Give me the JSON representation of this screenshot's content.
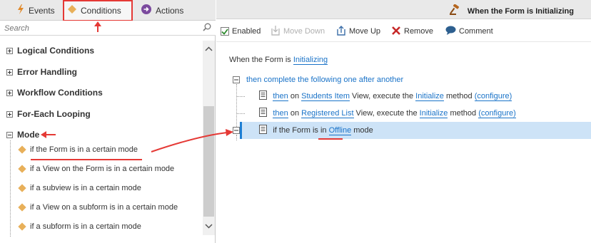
{
  "tabs": [
    {
      "label": "Events",
      "icon": "lightning-icon"
    },
    {
      "label": "Conditions",
      "icon": "diamond-icon"
    },
    {
      "label": "Actions",
      "icon": "arrow-right-circle-icon"
    }
  ],
  "search": {
    "placeholder": "Search"
  },
  "groups": [
    {
      "label": "Logical Conditions",
      "expanded": false
    },
    {
      "label": "Error Handling",
      "expanded": false
    },
    {
      "label": "Workflow Conditions",
      "expanded": false
    },
    {
      "label": "For-Each Looping",
      "expanded": false
    },
    {
      "label": "Mode",
      "expanded": true
    }
  ],
  "mode_items": [
    "if the Form is in a certain mode",
    "if a View on the Form is in a certain mode",
    "if a subview is in a certain mode",
    "if a View on a subform is in a certain mode",
    "if a subform is in a certain mode"
  ],
  "header": {
    "title": "When the Form is Initializing",
    "icon": "gavel-icon"
  },
  "toolbar": {
    "enabled": "Enabled",
    "enabled_checked": true,
    "move_down": "Move Down",
    "move_up": "Move Up",
    "remove": "Remove",
    "comment": "Comment"
  },
  "rule": {
    "when_prefix": "When the Form is ",
    "when_event": "Initializing",
    "then_block": "then complete the following one after another",
    "action1": {
      "then": "then",
      "on": " on ",
      "target": "Students Item",
      "mid": " View, execute the ",
      "method": "Initialize",
      "suffix": " method ",
      "configure": "(configure)"
    },
    "action2": {
      "then": "then",
      "on": " on ",
      "target": "Registered List",
      "mid": " View, execute the ",
      "method": "Initialize",
      "suffix": " method ",
      "configure": "(configure)"
    },
    "condition": {
      "prefix": "if the Form is in ",
      "mode": "Offline",
      "suffix": " mode"
    }
  },
  "colors": {
    "annotation": "#e53935",
    "link": "#1a73c8",
    "selection": "#cde3f7",
    "diamond": "#e8b05a"
  }
}
